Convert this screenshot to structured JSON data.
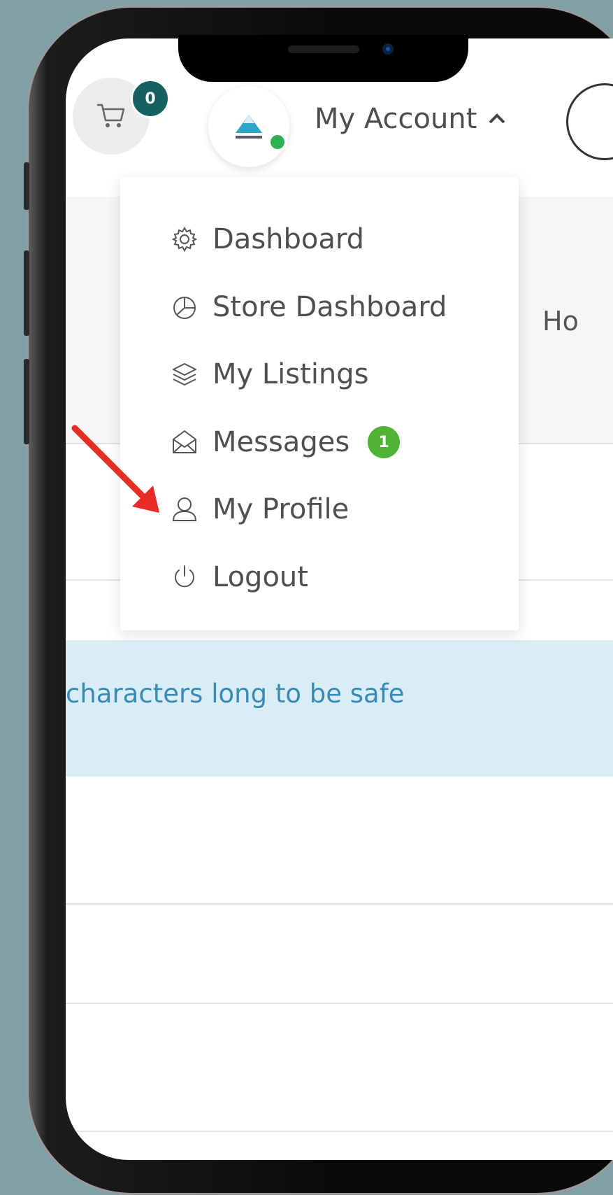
{
  "header": {
    "cart_count": "0",
    "account_label": "My Account",
    "partial_nav_text": "Ho"
  },
  "menu": {
    "items": [
      {
        "label": "Dashboard",
        "icon": "gear-icon"
      },
      {
        "label": "Store Dashboard",
        "icon": "pie-chart-icon"
      },
      {
        "label": "My Listings",
        "icon": "layers-icon"
      },
      {
        "label": "Messages",
        "icon": "envelope-open-icon",
        "badge": "1"
      },
      {
        "label": "My Profile",
        "icon": "user-icon"
      },
      {
        "label": "Logout",
        "icon": "power-icon"
      }
    ]
  },
  "alert": {
    "text": "characters long to be safe"
  },
  "annotation": {
    "arrow_color": "#e82b25",
    "points_to": "My Profile"
  },
  "colors": {
    "cart_badge": "#15615f",
    "message_badge": "#4fb336",
    "online_dot": "#2db154",
    "alert_bg": "#d9edf7",
    "alert_text": "#3a8ab4",
    "background": "#7fa0a6"
  }
}
